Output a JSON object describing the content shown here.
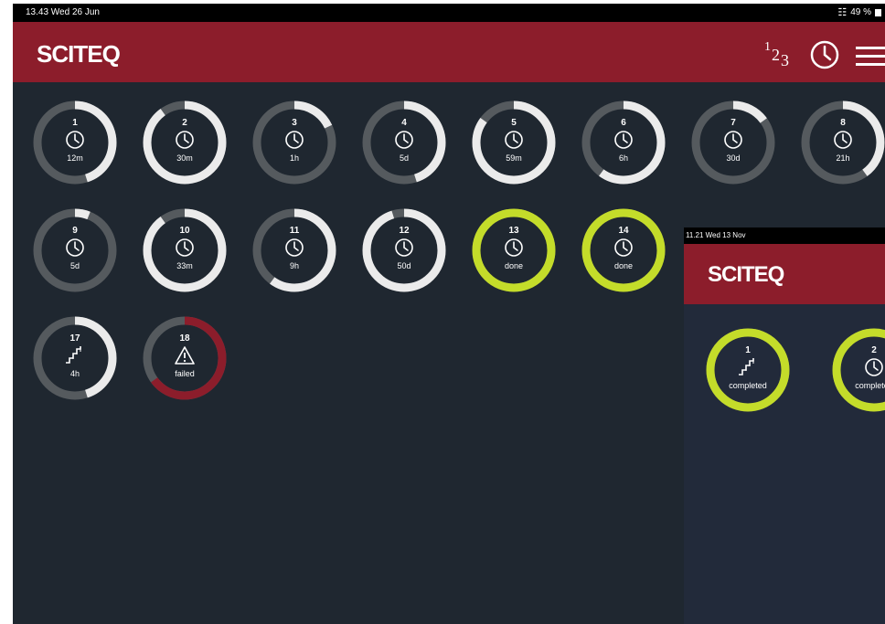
{
  "status_bar": {
    "time": "13.43  Wed 26 Jun",
    "wifi_icon": "wifi-icon",
    "battery": "49 %"
  },
  "header": {
    "logo": "SCITEQ",
    "numbers_button": {
      "d1": "1",
      "d2": "2",
      "d3": "3"
    },
    "icons": [
      "numbers-icon",
      "clock-icon",
      "hamburger-menu-icon"
    ]
  },
  "colors": {
    "background": "#1f2730",
    "header": "#8c1d2b",
    "ring_track": "#555a5e",
    "ring_progress": "#ebebeb",
    "ring_done": "#c4dc2a",
    "ring_failed": "#8c1d2b"
  },
  "tasks": [
    {
      "number": "1",
      "label": "12m",
      "icon": "clock-icon",
      "state": "running",
      "progress": 0.45
    },
    {
      "number": "2",
      "label": "30m",
      "icon": "clock-icon",
      "state": "running",
      "progress": 0.9
    },
    {
      "number": "3",
      "label": "1h",
      "icon": "clock-icon",
      "state": "running",
      "progress": 0.18
    },
    {
      "number": "4",
      "label": "5d",
      "icon": "clock-icon",
      "state": "running",
      "progress": 0.45
    },
    {
      "number": "5",
      "label": "59m",
      "icon": "clock-icon",
      "state": "running",
      "progress": 0.85
    },
    {
      "number": "6",
      "label": "6h",
      "icon": "clock-icon",
      "state": "running",
      "progress": 0.6
    },
    {
      "number": "7",
      "label": "30d",
      "icon": "clock-icon",
      "state": "running",
      "progress": 0.15
    },
    {
      "number": "8",
      "label": "21h",
      "icon": "clock-icon",
      "state": "running",
      "progress": 0.4
    },
    {
      "number": "9",
      "label": "5d",
      "icon": "clock-icon",
      "state": "running",
      "progress": 0.06
    },
    {
      "number": "10",
      "label": "33m",
      "icon": "clock-icon",
      "state": "running",
      "progress": 0.9
    },
    {
      "number": "11",
      "label": "9h",
      "icon": "clock-icon",
      "state": "running",
      "progress": 0.6
    },
    {
      "number": "12",
      "label": "50d",
      "icon": "clock-icon",
      "state": "running",
      "progress": 0.95
    },
    {
      "number": "13",
      "label": "done",
      "icon": "clock-icon",
      "state": "done",
      "progress": 1
    },
    {
      "number": "14",
      "label": "done",
      "icon": "clock-icon",
      "state": "done",
      "progress": 1
    },
    {
      "number": "17",
      "label": "4h",
      "icon": "steps-icon",
      "state": "running",
      "progress": 0.45
    },
    {
      "number": "18",
      "label": "failed",
      "icon": "warning-icon",
      "state": "failed",
      "progress": 0.65
    }
  ],
  "overlay": {
    "status_time": "11.21  Wed 13 Nov",
    "logo": "SCITEQ",
    "tasks": [
      {
        "number": "1",
        "label": "completed",
        "icon": "steps-icon",
        "state": "done",
        "progress": 1
      },
      {
        "number": "2",
        "label": "completed",
        "icon": "clock-icon",
        "state": "done",
        "progress": 1
      }
    ]
  }
}
